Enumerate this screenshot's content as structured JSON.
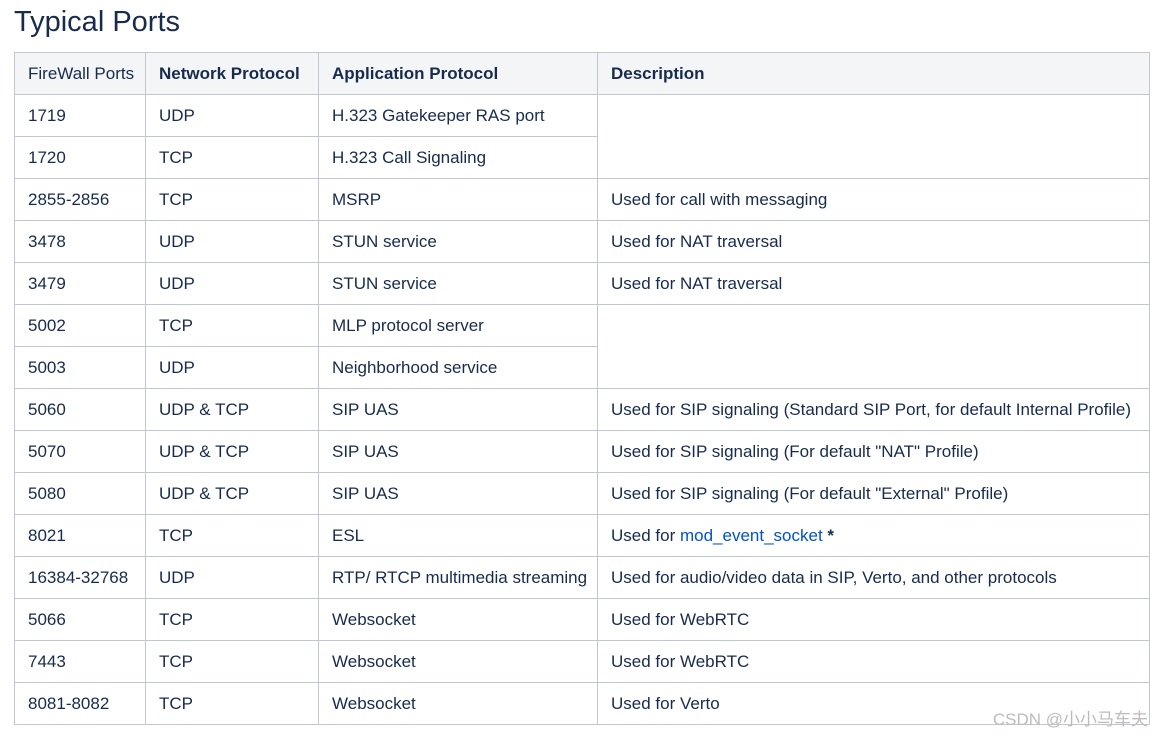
{
  "page": {
    "title": "Typical Ports"
  },
  "table": {
    "headers": [
      "FireWall Ports",
      "Network Protocol",
      "Application Protocol",
      "Description"
    ],
    "rows": [
      [
        "1719",
        "UDP",
        "H.323 Gatekeeper RAS port",
        ""
      ],
      [
        "1720",
        "TCP",
        "H.323 Call Signaling",
        ""
      ],
      [
        "2855-2856",
        "TCP",
        "MSRP",
        "Used for call with messaging"
      ],
      [
        "3478",
        "UDP",
        "STUN service",
        "Used for NAT traversal"
      ],
      [
        "3479",
        "UDP",
        "STUN service",
        "Used for NAT traversal"
      ],
      [
        "5002",
        "TCP",
        "MLP protocol server",
        ""
      ],
      [
        "5003",
        "UDP",
        "Neighborhood service",
        ""
      ],
      [
        "5060",
        "UDP & TCP",
        "SIP UAS",
        "Used for SIP signaling (Standard SIP Port, for default Internal Profile)"
      ],
      [
        "5070",
        "UDP & TCP",
        "SIP UAS",
        "Used for SIP signaling (For default \"NAT\" Profile)"
      ],
      [
        "5080",
        "UDP & TCP",
        "SIP UAS",
        "Used for SIP signaling (For default \"External\" Profile)"
      ],
      [
        "8021",
        "TCP",
        "ESL",
        ""
      ],
      [
        "16384-32768",
        "UDP",
        "RTP/ RTCP multimedia streaming",
        "Used for audio/video data in SIP, Verto, and other protocols"
      ],
      [
        "5066",
        "TCP",
        "Websocket",
        "Used for WebRTC"
      ],
      [
        "7443",
        "TCP",
        "Websocket",
        "Used for WebRTC"
      ],
      [
        "8081-8082",
        "TCP",
        "Websocket",
        "Used for Verto"
      ]
    ],
    "esl_description": {
      "prefix": "Used for ",
      "link_text": "mod_event_socket",
      "suffix": " *"
    }
  },
  "watermark": "CSDN @小小马车夫"
}
